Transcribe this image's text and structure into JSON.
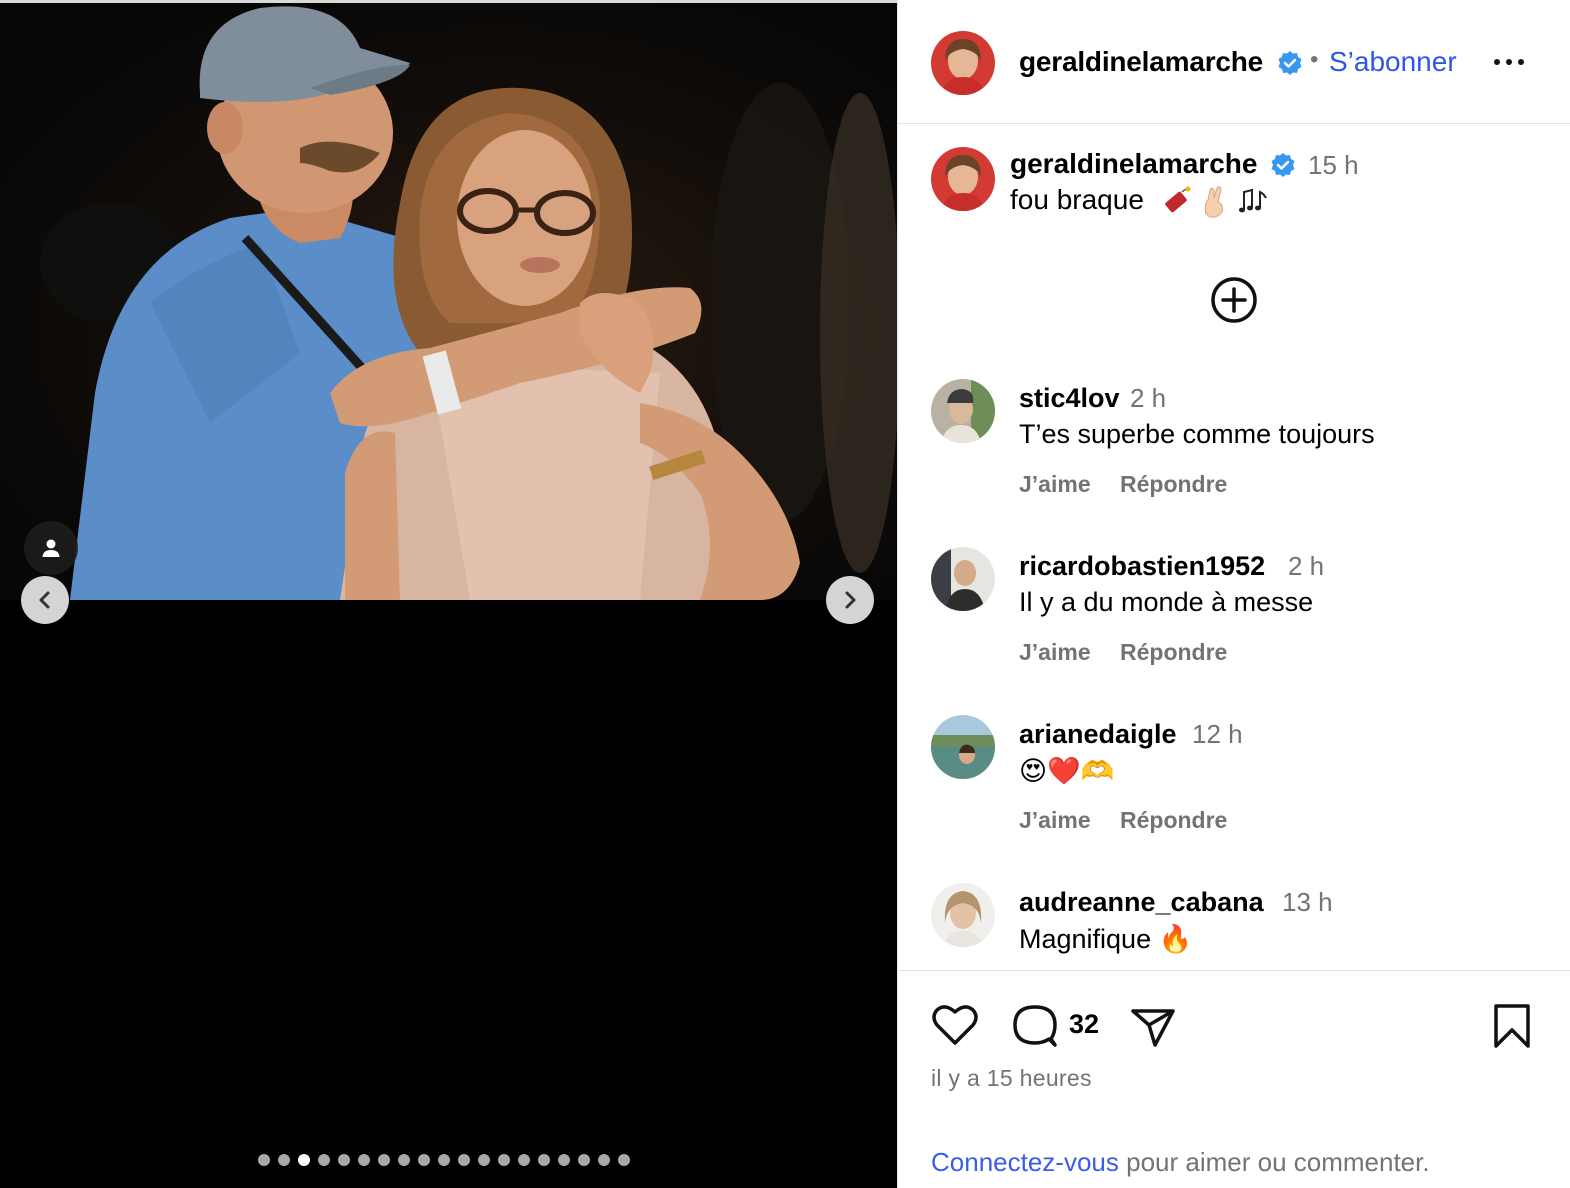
{
  "media": {
    "carousel_total": 19,
    "carousel_active_index": 2
  },
  "post": {
    "author": "geraldinelamarche",
    "follow_label": "S’abonner",
    "separator": "•",
    "caption_time": "15 h",
    "caption_text": "fou braque",
    "caption_emojis": [
      "firecracker-emoji",
      "crossed-fingers-emoji",
      "music-notes-emoji"
    ]
  },
  "comments": [
    {
      "user": "stic4lov",
      "time": "2 h",
      "text": "T’es superbe comme toujours",
      "like_label": "J’aime",
      "reply_label": "Répondre"
    },
    {
      "user": "ricardobastien1952",
      "time": "2 h",
      "text": "Il y a du monde à messe",
      "like_label": "J’aime",
      "reply_label": "Répondre"
    },
    {
      "user": "arianedaigle",
      "time": "12 h",
      "text": "😍❤️🫶",
      "like_label": "J’aime",
      "reply_label": "Répondre"
    },
    {
      "user": "audreanne_cabana",
      "time": "13 h",
      "text": "Magnifique 🔥"
    }
  ],
  "actions": {
    "comment_count": "32",
    "time_ago": "il y a 15 heures"
  },
  "login": {
    "link_label": "Connectez-vous",
    "rest_text": " pour aimer ou commenter."
  },
  "colors": {
    "accent_blue": "#2f56e8",
    "verified_blue": "#3897f0",
    "muted_text": "#737373"
  }
}
